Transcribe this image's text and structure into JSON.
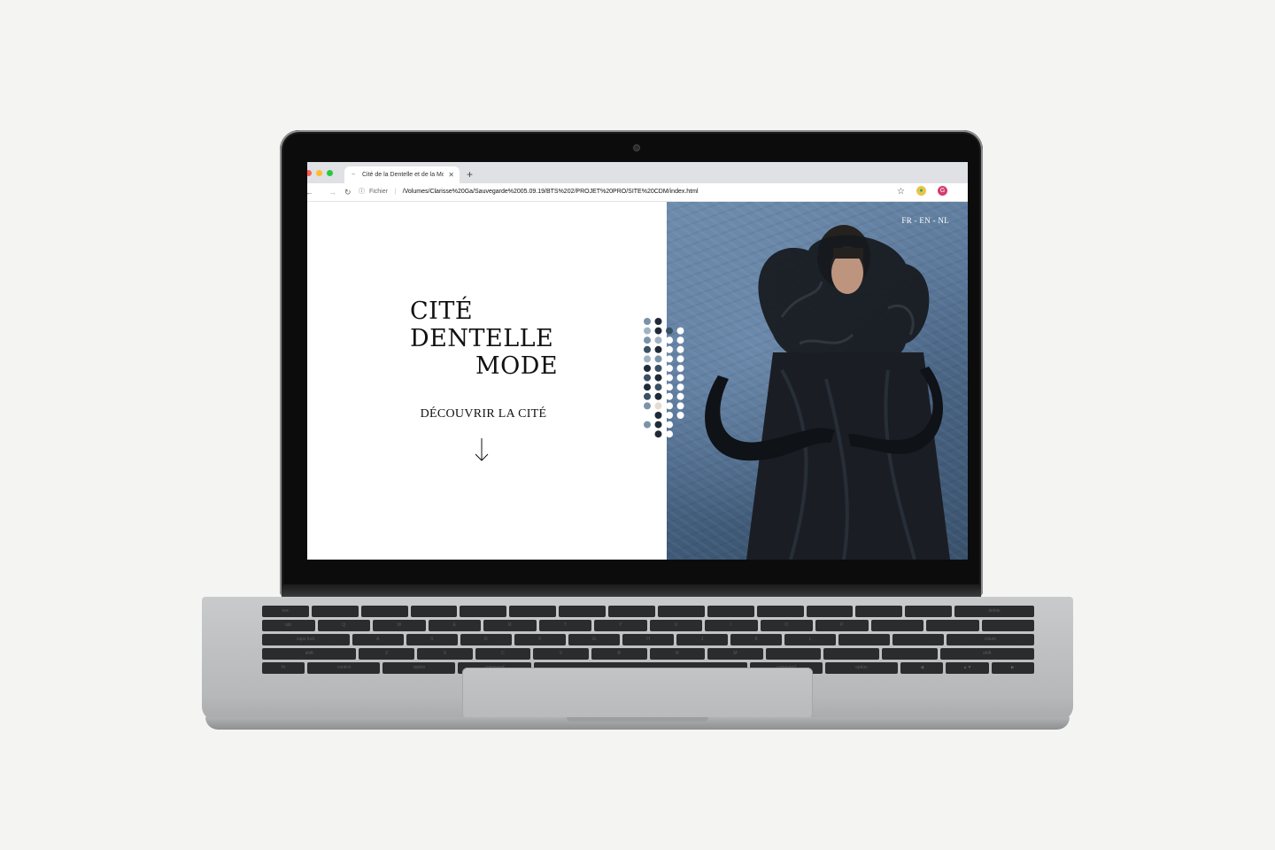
{
  "browser": {
    "tab_title": "Cité de la Dentelle et de la Mode",
    "tab_close": "✕",
    "new_tab": "+",
    "url_scheme": "Fichier",
    "url_path": "/Volumes/Clarisse%20Ga/Sauvegarde%2005.09.19/BTS%202/PROJET%20PRO/SITE%20CDM/index.html",
    "profile_initial": "G",
    "icons": [
      "back-arrow-icon",
      "forward-arrow-icon",
      "reload-icon",
      "info-icon",
      "star-icon",
      "extension-icon",
      "profile-avatar"
    ]
  },
  "page": {
    "title_lines": [
      "CITÉ",
      "DENTELLE",
      "MODE"
    ],
    "cta_label": "DÉCOUVRIR LA CITÉ",
    "lang_switch": "FR - EN - NL",
    "arrow_icon": "arrow-down-icon"
  },
  "keyboard": {
    "row_top": [
      "esc",
      "",
      "",
      "",
      "",
      "",
      "",
      "",
      "",
      "",
      "",
      "",
      "",
      "",
      "delete"
    ],
    "row_2": [
      "tab",
      "Q",
      "W",
      "E",
      "R",
      "T",
      "Y",
      "U",
      "I",
      "O",
      "P",
      "",
      "",
      ""
    ],
    "row_3": [
      "caps lock",
      "A",
      "S",
      "D",
      "F",
      "G",
      "H",
      "J",
      "K",
      "L",
      "",
      "",
      "return"
    ],
    "row_4": [
      "shift",
      "Z",
      "X",
      "C",
      "V",
      "B",
      "N",
      "M",
      "",
      "",
      "",
      "shift"
    ],
    "row_5": [
      "fn",
      "control",
      "option",
      "command",
      "",
      "command",
      "option",
      "◀",
      "▲▼",
      "▶"
    ]
  },
  "colors": {
    "dot_palette": [
      "#1f2a36",
      "#3a5064",
      "#7a93a8",
      "#9fb3c3",
      "#e6dbd3",
      "#ffffff"
    ]
  }
}
